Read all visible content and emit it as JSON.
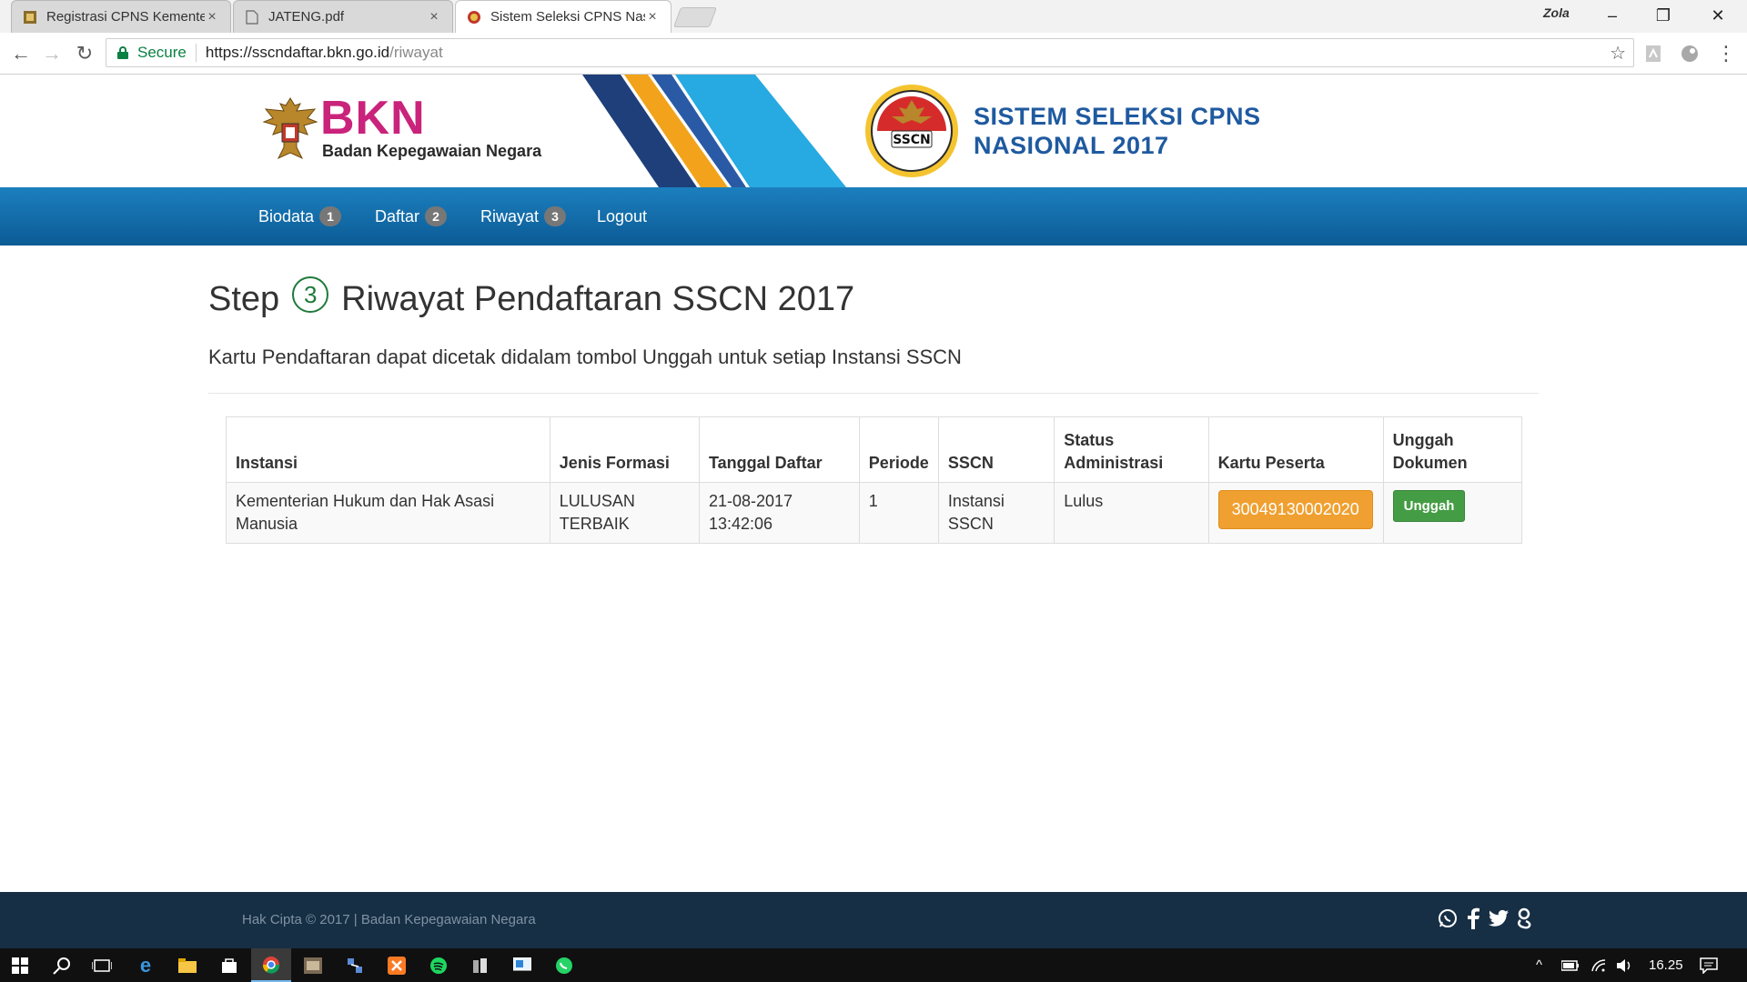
{
  "browser": {
    "tabs": [
      {
        "title": "Registrasi CPNS Kementerian Hukum",
        "active": false
      },
      {
        "title": "JATENG.pdf",
        "active": false
      },
      {
        "title": "Sistem Seleksi CPNS Nasional",
        "active": true
      }
    ],
    "close_glyph": "×",
    "user_name": "Zola",
    "window_controls": {
      "minimize": "–",
      "maximize": "❐",
      "close": "✕"
    },
    "nav": {
      "back": "←",
      "forward": "→",
      "reload": "↻"
    },
    "secure_label": "Secure",
    "url_host": "https://sscndaftar.bkn.go.id",
    "url_path": "/riwayat",
    "bookmark_icon": "☆",
    "menu_icon": "⋮"
  },
  "header": {
    "bkn_logo_text": "BKN",
    "bkn_subtitle": "Badan Kepegawaian Negara",
    "seal_text": "SSCN",
    "sscn_title_line1": "SISTEM SELEKSI CPNS",
    "sscn_title_line2": "NASIONAL 2017"
  },
  "nav": {
    "items": [
      {
        "label": "Biodata",
        "badge": "1"
      },
      {
        "label": "Daftar",
        "badge": "2"
      },
      {
        "label": "Riwayat",
        "badge": "3"
      },
      {
        "label": "Logout",
        "badge": ""
      }
    ]
  },
  "content": {
    "step_word": "Step",
    "step_number": "3",
    "title": "Riwayat Pendaftaran SSCN 2017",
    "subtitle": "Kartu Pendaftaran dapat dicetak didalam tombol Unggah untuk setiap Instansi SSCN"
  },
  "table": {
    "headers": [
      "Instansi",
      "Jenis Formasi",
      "Tanggal Daftar",
      "Periode",
      "SSCN",
      "Status Administrasi",
      "Kartu Peserta",
      "Unggah Dokumen"
    ],
    "rows": [
      {
        "instansi": "Kementerian Hukum dan Hak Asasi Manusia",
        "jenis_formasi": "LULUSAN TERBAIK",
        "tanggal_daftar": "21-08-2017 13:42:06",
        "periode": "1",
        "sscn": "Instansi SSCN",
        "status": "Lulus",
        "kartu_peserta": "30049130002020",
        "unggah_label": "Unggah"
      }
    ]
  },
  "footer": {
    "copyright": "Hak Cipta © 2017 | Badan Kepegawaian Negara",
    "social": [
      "whatsapp",
      "facebook",
      "twitter",
      "google-plus"
    ]
  },
  "taskbar": {
    "clock": "16.25",
    "apps": [
      "start",
      "search",
      "task-view",
      "edge",
      "file-explorer",
      "store",
      "chrome",
      "app-1",
      "app-2",
      "xampp",
      "spotify",
      "app-3",
      "app-4",
      "whatsapp"
    ]
  },
  "colors": {
    "brand_blue": "#0b5b95",
    "bkn_magenta": "#c9237b",
    "sscn_blue": "#1f5aa0",
    "kartu_orange": "#f0a030",
    "unggah_green": "#449d44",
    "footer_navy": "#162f45"
  }
}
